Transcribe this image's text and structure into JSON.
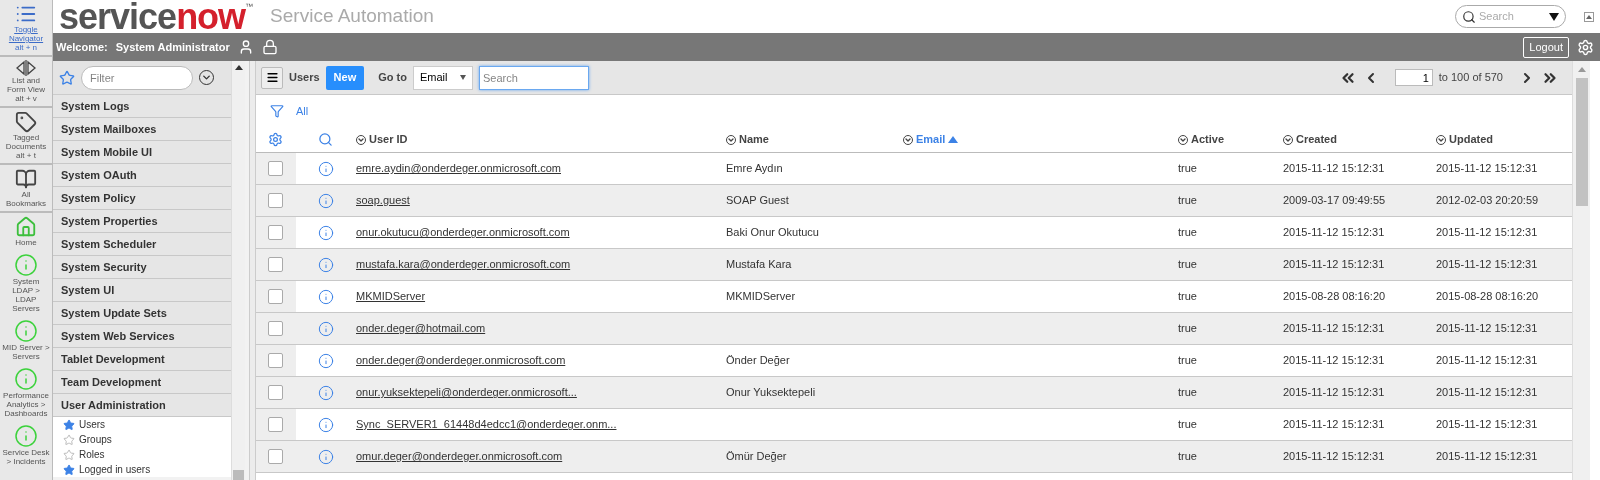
{
  "rail": [
    {
      "kind": "list",
      "label": "Toggle Navigator",
      "shortcut": "alt + n",
      "link": true
    },
    {
      "kind": "split",
      "label": "List and Form View",
      "shortcut": "alt + v",
      "link": false
    },
    {
      "kind": "tag",
      "label": "Tagged Documents",
      "shortcut": "alt + t",
      "link": false
    },
    {
      "kind": "book",
      "label": "All Bookmarks",
      "link": false
    },
    {
      "kind": "home",
      "label": "Home",
      "link": false
    },
    {
      "kind": "info",
      "label": "System LDAP > LDAP Servers",
      "link": false
    },
    {
      "kind": "info",
      "label": "MID Server > Servers",
      "link": false
    },
    {
      "kind": "info",
      "label": "Performance Analytics > Dashboards",
      "link": false
    },
    {
      "kind": "info",
      "label": "Service Desk > Incidents",
      "link": false
    }
  ],
  "header": {
    "logo": {
      "first": "service",
      "second": "now",
      "mark": "™"
    },
    "title": "Service Automation",
    "search_placeholder": "Search"
  },
  "user_bar": {
    "welcome": "Welcome:",
    "user": "System Administrator",
    "logout": "Logout"
  },
  "navigator": {
    "filter_placeholder": "Filter",
    "items": [
      {
        "label": "System Logs"
      },
      {
        "label": "System Mailboxes"
      },
      {
        "label": "System Mobile UI"
      },
      {
        "label": "System OAuth"
      },
      {
        "label": "System Policy"
      },
      {
        "label": "System Properties"
      },
      {
        "label": "System Scheduler"
      },
      {
        "label": "System Security"
      },
      {
        "label": "System UI"
      },
      {
        "label": "System Update Sets"
      },
      {
        "label": "System Web Services"
      },
      {
        "label": "Tablet Development"
      },
      {
        "label": "Team Development"
      },
      {
        "label": "User Administration",
        "children": [
          {
            "label": "Users",
            "starred": true
          },
          {
            "label": "Groups",
            "starred": false
          },
          {
            "label": "Roles",
            "starred": false
          },
          {
            "label": "Logged in users",
            "starred": true
          }
        ]
      }
    ]
  },
  "toolbar": {
    "title": "Users",
    "new": "New",
    "goto": "Go to",
    "goto_field": "Email",
    "search_placeholder": "Search",
    "page": "1",
    "range": "to 100 of 570"
  },
  "filter": {
    "label": "All"
  },
  "table": {
    "columns": [
      {
        "label": "User ID",
        "sorted": false
      },
      {
        "label": "Name",
        "sorted": false
      },
      {
        "label": "Email",
        "sorted": true
      },
      {
        "label": "Active",
        "sorted": false
      },
      {
        "label": "Created",
        "sorted": false
      },
      {
        "label": "Updated",
        "sorted": false
      }
    ],
    "rows": [
      {
        "checked": false,
        "user_id": "emre.aydin@onderdeger.onmicrosoft.com",
        "name": "Emre Aydın",
        "active": "true",
        "created": "2015-11-12 15:12:31",
        "updated": "2015-11-12 15:12:31"
      },
      {
        "checked": false,
        "user_id": "soap.guest",
        "name": "SOAP Guest",
        "active": "true",
        "created": "2009-03-17 09:49:55",
        "updated": "2012-02-03 20:20:59"
      },
      {
        "checked": false,
        "user_id": "onur.okutucu@onderdeger.onmicrosoft.com",
        "name": "Baki Onur Okutucu",
        "active": "true",
        "created": "2015-11-12 15:12:31",
        "updated": "2015-11-12 15:12:31"
      },
      {
        "checked": false,
        "user_id": "mustafa.kara@onderdeger.onmicrosoft.com",
        "name": "Mustafa Kara",
        "active": "true",
        "created": "2015-11-12 15:12:31",
        "updated": "2015-11-12 15:12:31"
      },
      {
        "checked": false,
        "user_id": "MKMIDServer",
        "name": "MKMIDServer",
        "active": "true",
        "created": "2015-08-28 08:16:20",
        "updated": "2015-08-28 08:16:20"
      },
      {
        "checked": false,
        "user_id": "onder.deger@hotmail.com",
        "active": "true",
        "created": "2015-11-12 15:12:31",
        "updated": "2015-11-12 15:12:31"
      },
      {
        "checked": false,
        "user_id": "onder.deger@onderdeger.onmicrosoft.com",
        "name": "Önder Değer",
        "active": "true",
        "created": "2015-11-12 15:12:31",
        "updated": "2015-11-12 15:12:31"
      },
      {
        "checked": false,
        "user_id": "onur.yuksektepeli@onderdeger.onmicrosoft...",
        "name": "Onur Yuksektepeli",
        "active": "true",
        "created": "2015-11-12 15:12:31",
        "updated": "2015-11-12 15:12:31"
      },
      {
        "checked": false,
        "user_id": "Sync_SERVER1_61448d4edcc1@onderdeger.onm...",
        "active": "true",
        "created": "2015-11-12 15:12:31",
        "updated": "2015-11-12 15:12:31"
      },
      {
        "checked": false,
        "user_id": "omur.deger@onderdeger.onmicrosoft.com",
        "name": "Ömür Değer",
        "active": "true",
        "created": "2015-11-12 15:12:31",
        "updated": "2015-11-12 15:12:31"
      }
    ]
  }
}
